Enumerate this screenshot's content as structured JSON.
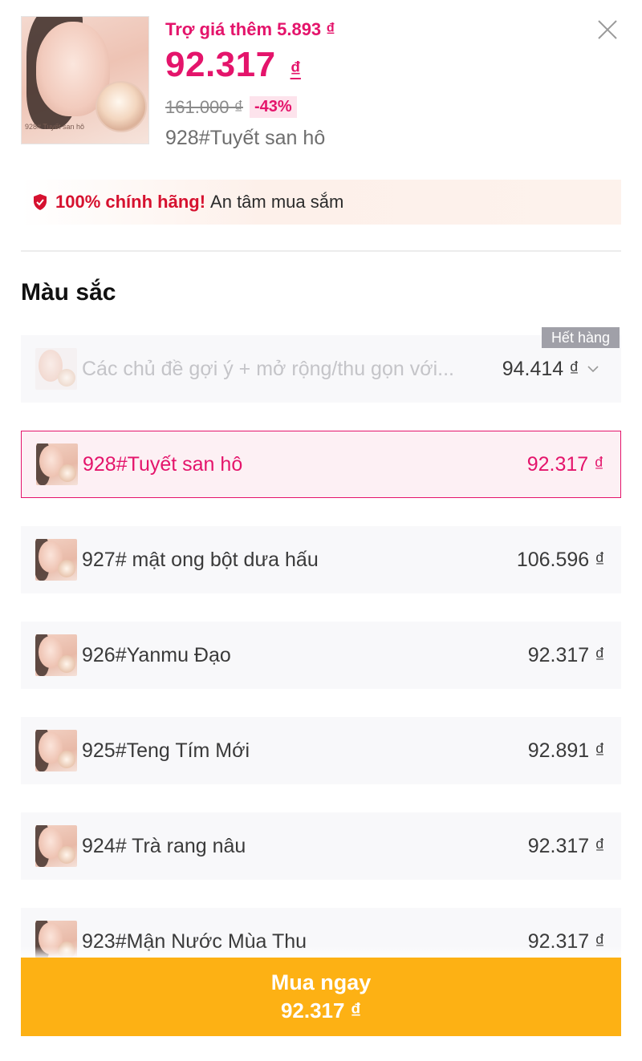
{
  "header": {
    "subsidy_text": "Trợ giá thêm 5.893 ₫",
    "price": "92.317",
    "currency": "₫",
    "original_price": "161.000 ₫",
    "discount": "-43%",
    "selected_variant": "928#Tuyết san hô",
    "thumb_caption": "928# Tuyết san hô"
  },
  "authenticity": {
    "strong": "100% chính hãng!",
    "rest": "An tâm mua sắm"
  },
  "section": {
    "title": "Màu sắc"
  },
  "options": [
    {
      "label": "Các chủ đề gợi ý + mở rộng/thu gọn với...",
      "price": "94.414 ₫",
      "status": "disabled",
      "badge": "Hết hàng"
    },
    {
      "label": "928#Tuyết san hô",
      "price": "92.317 ₫",
      "status": "selected"
    },
    {
      "label": "927# mật ong bột dưa hấu",
      "price": "106.596 ₫",
      "status": "normal"
    },
    {
      "label": "926#Yanmu Đạo",
      "price": "92.317 ₫",
      "status": "normal"
    },
    {
      "label": "925#Teng Tím Mới",
      "price": "92.891 ₫",
      "status": "normal"
    },
    {
      "label": "924# Trà rang nâu",
      "price": "92.317 ₫",
      "status": "normal"
    },
    {
      "label": "923#Mận Nước Mùa Thu",
      "price": "92.317 ₫",
      "status": "normal"
    }
  ],
  "buy": {
    "label": "Mua ngay",
    "price": "92.317 ₫"
  },
  "colors": {
    "accent": "#e4146b",
    "buy_button": "#fdb114",
    "authentic_red": "#d6112f",
    "out_of_stock_badge": "#a0a0a8"
  },
  "icons": {
    "close": "close-icon",
    "shield": "shield-check-icon",
    "chevron": "chevron-down-icon"
  }
}
